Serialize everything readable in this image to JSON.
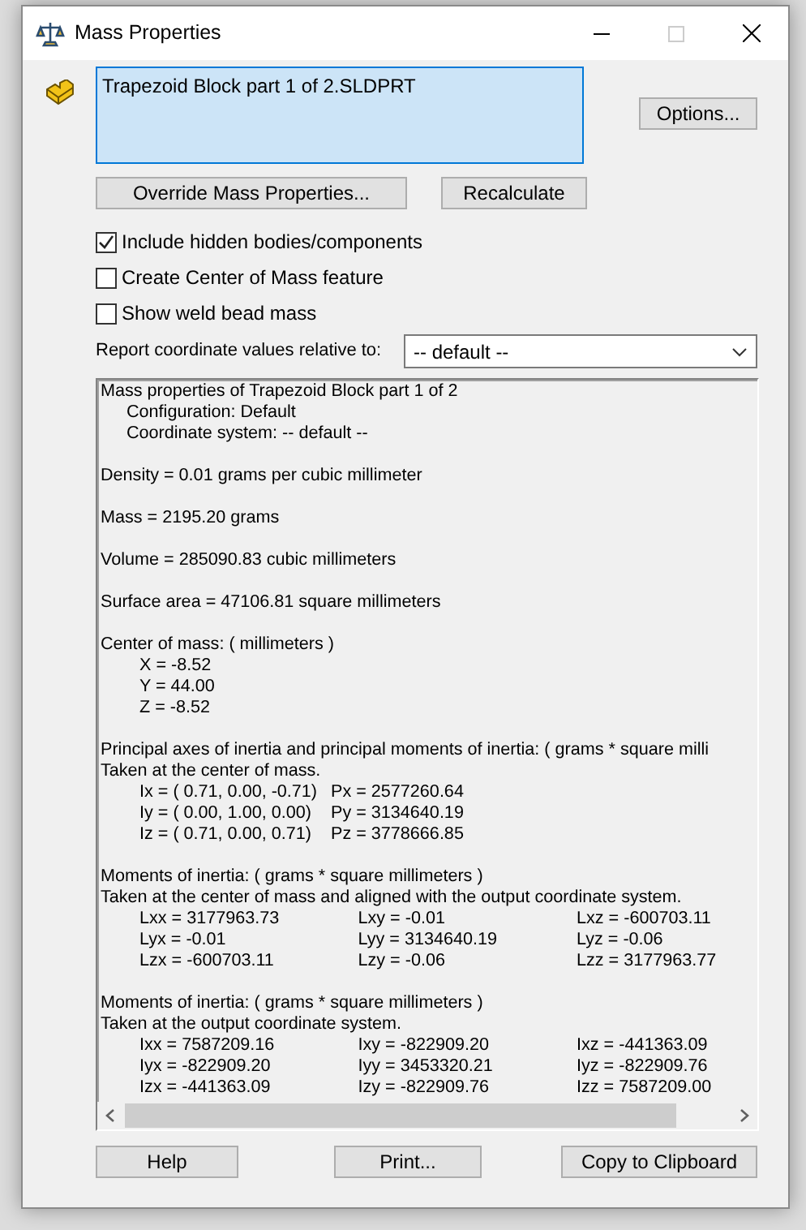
{
  "window": {
    "title": "Mass Properties"
  },
  "file_name": "Trapezoid Block part 1 of 2.SLDPRT",
  "options_button": "Options...",
  "action_buttons": [
    "Override Mass Properties...",
    "Recalculate"
  ],
  "checkboxes": [
    {
      "label": "Include hidden bodies/components",
      "checked": true
    },
    {
      "label": "Create Center of Mass feature",
      "checked": false
    },
    {
      "label": "Show weld bead mass",
      "checked": false
    }
  ],
  "coordinate_select": {
    "label": "Report coordinate values relative to:",
    "value": "-- default --"
  },
  "report": {
    "lines": [
      {
        "kind": "text",
        "text": "Mass properties of Trapezoid Block part 1 of 2"
      },
      {
        "kind": "subtext",
        "text": "Configuration: Default"
      },
      {
        "kind": "subtext",
        "text": "Coordinate system: -- default --"
      },
      {
        "kind": "blank"
      },
      {
        "kind": "text",
        "text": "Density = 0.01 grams per cubic millimeter"
      },
      {
        "kind": "blank"
      },
      {
        "kind": "text",
        "text": "Mass = 2195.20 grams"
      },
      {
        "kind": "blank"
      },
      {
        "kind": "text",
        "text": "Volume = 285090.83 cubic millimeters"
      },
      {
        "kind": "blank"
      },
      {
        "kind": "text",
        "text": "Surface area = 47106.81  square millimeters"
      },
      {
        "kind": "blank"
      },
      {
        "kind": "text",
        "text": "Center of mass: ( millimeters )"
      },
      {
        "kind": "values",
        "cells": [
          "X = -8.52"
        ]
      },
      {
        "kind": "values",
        "cells": [
          "Y = 44.00"
        ]
      },
      {
        "kind": "values",
        "cells": [
          "Z = -8.52"
        ]
      },
      {
        "kind": "blank"
      },
      {
        "kind": "text",
        "text": "Principal axes of inertia and principal moments of inertia: ( grams *  square milli"
      },
      {
        "kind": "text",
        "text": "Taken at the center of mass."
      },
      {
        "kind": "axes",
        "cells": [
          "Ix = ( 0.71,  0.00, -0.71)",
          "Px = 2577260.64"
        ]
      },
      {
        "kind": "axes",
        "cells": [
          "Iy = ( 0.00,  1.00,  0.00)",
          "Py = 3134640.19"
        ]
      },
      {
        "kind": "axes",
        "cells": [
          "Iz = ( 0.71,  0.00,  0.71)",
          "Pz = 3778666.85"
        ]
      },
      {
        "kind": "blank"
      },
      {
        "kind": "text",
        "text": "Moments of inertia: ( grams *  square millimeters )"
      },
      {
        "kind": "text",
        "text": "Taken at the center of mass and aligned with the output coordinate system."
      },
      {
        "kind": "values",
        "cells": [
          "Lxx = 3177963.73",
          "Lxy = -0.01",
          "Lxz = -600703.11"
        ]
      },
      {
        "kind": "values",
        "cells": [
          "Lyx = -0.01",
          "Lyy = 3134640.19",
          "Lyz = -0.06"
        ]
      },
      {
        "kind": "values",
        "cells": [
          "Lzx = -600703.11",
          "Lzy = -0.06",
          "Lzz = 3177963.77"
        ]
      },
      {
        "kind": "blank"
      },
      {
        "kind": "text",
        "text": "Moments of inertia: ( grams *  square millimeters )"
      },
      {
        "kind": "text",
        "text": "Taken at the output coordinate system."
      },
      {
        "kind": "values",
        "cells": [
          "Ixx = 7587209.16",
          "Ixy = -822909.20",
          "Ixz = -441363.09"
        ]
      },
      {
        "kind": "values",
        "cells": [
          "Iyx = -822909.20",
          "Iyy = 3453320.21",
          "Iyz = -822909.76"
        ]
      },
      {
        "kind": "values",
        "cells": [
          "Izx = -441363.09",
          "Izy = -822909.76",
          "Izz = 7587209.00"
        ]
      }
    ]
  },
  "bottom_buttons": [
    "Help",
    "Print...",
    "Copy to Clipboard"
  ]
}
